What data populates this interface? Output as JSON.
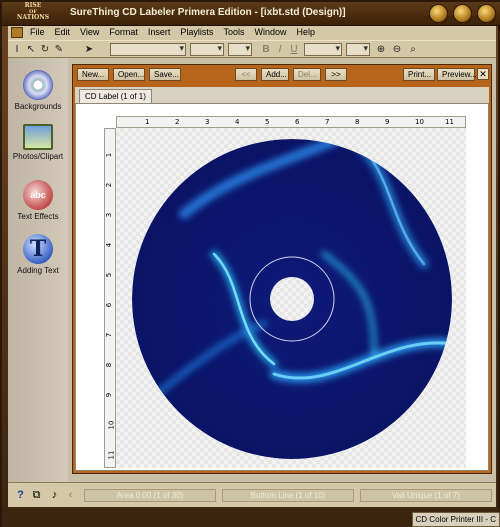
{
  "window": {
    "logo_lines": [
      "RISE",
      "OF",
      "NATIONS"
    ],
    "title": "SureThing CD Labeler Primera Edition - [ixbt.std (Design)]"
  },
  "menu": [
    "File",
    "Edit",
    "View",
    "Format",
    "Insert",
    "Playlists",
    "Tools",
    "Window",
    "Help"
  ],
  "toolbar": {
    "bold": "B",
    "italic": "I",
    "underline": "U"
  },
  "left_dock": [
    {
      "label": "Backgrounds",
      "icon": "cd-disc-icon"
    },
    {
      "label": "Photos/Clipart",
      "icon": "photo-frame-icon"
    },
    {
      "label": "Text Effects",
      "icon": "abc-sphere-icon"
    },
    {
      "label": "Adding Text",
      "icon": "letter-t-icon"
    }
  ],
  "doc_toolbar": {
    "new": "New...",
    "open": "Open...",
    "save": "Save...",
    "prev": "<<",
    "add": "Add...",
    "del": "Del...",
    "next": ">>",
    "print": "Print...",
    "preview": "Preview...",
    "close": "✕"
  },
  "tab": "CD Label (1 of 1)",
  "ruler": {
    "h_ticks": [
      "1",
      "2",
      "3",
      "4",
      "5",
      "6",
      "7",
      "8",
      "9",
      "10",
      "11"
    ],
    "v_ticks": [
      "1",
      "2",
      "3",
      "4",
      "5",
      "6",
      "7",
      "8",
      "9",
      "10",
      "11"
    ]
  },
  "status": {
    "field1": "Area 0.00 (1 of 30)",
    "field2": "Bottom Line (1 of 10)",
    "field3": "Vali Unique (1 of 7)"
  },
  "printer": "CD Color Printer III - C"
}
